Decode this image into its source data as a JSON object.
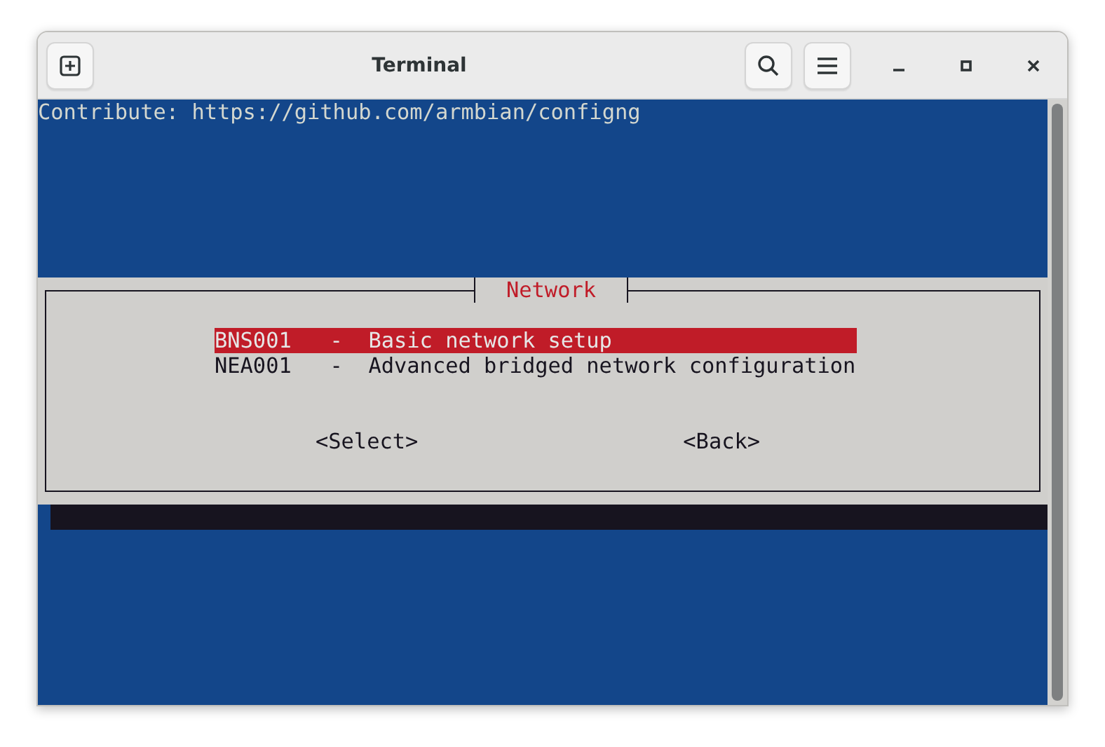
{
  "window": {
    "title": "Terminal"
  },
  "terminal": {
    "lines": [
      "Contribute: https://github.com/armbian/configng"
    ],
    "dialog": {
      "title": "Network",
      "items": [
        {
          "label": "BNS001   -  Basic network setup",
          "selected": true
        },
        {
          "label": "NEA001   -  Advanced bridged network configuration",
          "selected": false
        }
      ],
      "buttons": [
        "<Select>",
        "<Back>"
      ]
    }
  }
}
